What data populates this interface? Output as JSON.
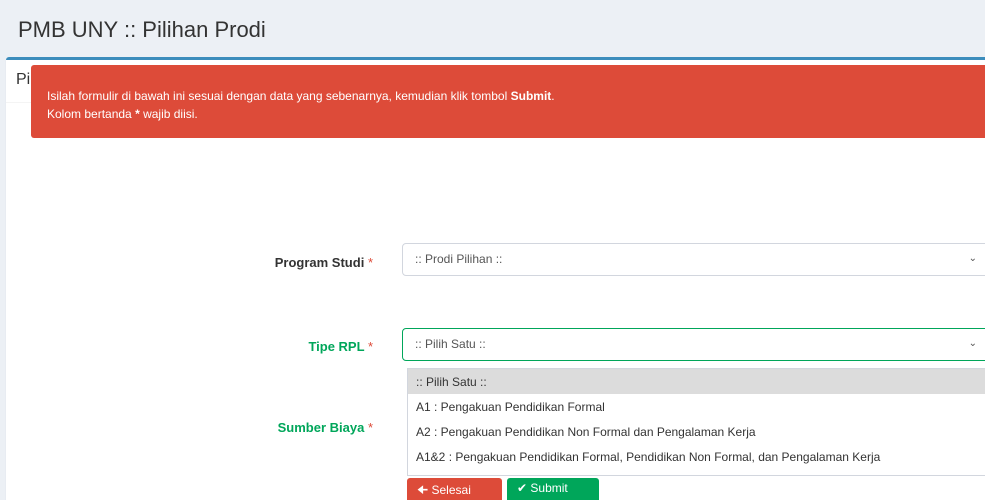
{
  "page": {
    "title": "PMB UNY :: Pilihan Prodi"
  },
  "box": {
    "title": "Pilihan Prodi"
  },
  "alert": {
    "line1_prefix": "Isilah formulir di bawah ini sesuai dengan data yang sebenarnya, kemudian klik tombol ",
    "line1_bold": "Submit",
    "line1_suffix": ".",
    "line2_prefix": "Kolom bertanda ",
    "line2_bold": "*",
    "line2_suffix": " wajib diisi."
  },
  "form": {
    "required_mark": "*",
    "program_studi": {
      "label": "Program Studi",
      "value": ":: Prodi Pilihan ::"
    },
    "tipe_rpl": {
      "label": "Tipe RPL",
      "value": ":: Pilih Satu ::",
      "options": [
        ":: Pilih Satu ::",
        "A1 : Pengakuan Pendidikan Formal",
        "A2 : Pengakuan Pendidikan Non Formal dan Pengalaman Kerja",
        "A1&2 : Pengakuan Pendidikan Formal, Pendidikan Non Formal, dan Pengalaman Kerja"
      ]
    },
    "sumber_biaya": {
      "label": "Sumber Biaya"
    }
  },
  "buttons": {
    "selesai": "Selesai",
    "submit": "Submit"
  },
  "icons": {
    "caret": "chevron-down-icon",
    "back": "arrow-left-icon",
    "check": "check-icon"
  },
  "colors": {
    "primary": "#3c8dbc",
    "danger": "#dd4b39",
    "success": "#00a65a"
  }
}
